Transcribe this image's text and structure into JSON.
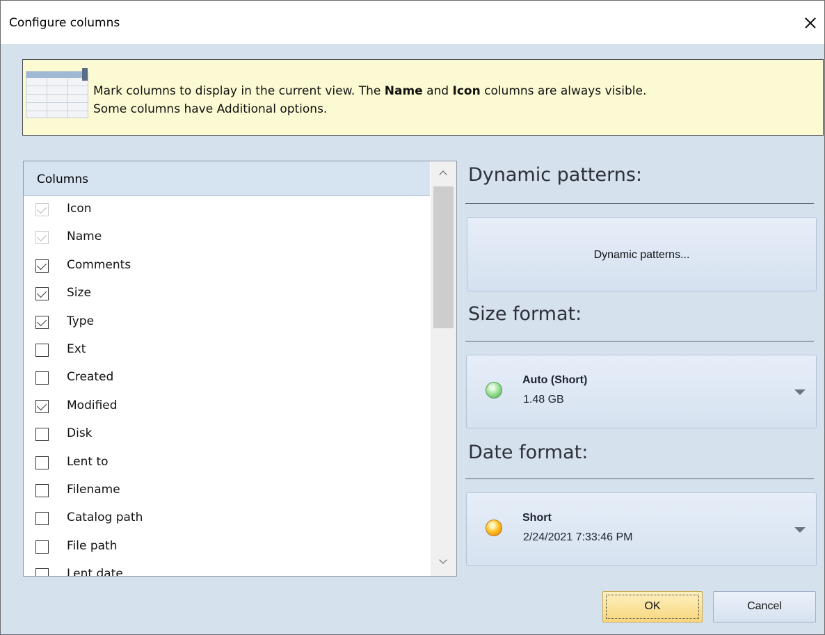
{
  "window": {
    "title": "Configure columns",
    "close_icon": "close-icon"
  },
  "info": {
    "icon": "table-columns-icon",
    "text_before": "Mark columns to display in the current view. The ",
    "bold1": "Name",
    "text_mid": " and ",
    "bold2": "Icon",
    "text_after": " columns are always visible.",
    "line2": "Some columns have Additional options."
  },
  "columns": {
    "header": "Columns",
    "items": [
      {
        "label": "Icon",
        "checked": true,
        "disabled": true
      },
      {
        "label": "Name",
        "checked": true,
        "disabled": true
      },
      {
        "label": "Comments",
        "checked": true,
        "disabled": false
      },
      {
        "label": "Size",
        "checked": true,
        "disabled": false
      },
      {
        "label": "Type",
        "checked": true,
        "disabled": false
      },
      {
        "label": "Ext",
        "checked": false,
        "disabled": false
      },
      {
        "label": "Created",
        "checked": false,
        "disabled": false
      },
      {
        "label": "Modified",
        "checked": true,
        "disabled": false
      },
      {
        "label": "Disk",
        "checked": false,
        "disabled": false
      },
      {
        "label": "Lent to",
        "checked": false,
        "disabled": false
      },
      {
        "label": "Filename",
        "checked": false,
        "disabled": false
      },
      {
        "label": "Catalog path",
        "checked": false,
        "disabled": false
      },
      {
        "label": "File path",
        "checked": false,
        "disabled": false
      },
      {
        "label": "Lent date",
        "checked": false,
        "disabled": false
      }
    ]
  },
  "dynamic": {
    "title": "Dynamic patterns:",
    "button_label": "Dynamic patterns..."
  },
  "size_format": {
    "title": "Size format:",
    "value": "Auto (Short)",
    "sample": "1.48 GB",
    "orb_color": "#7ed07a"
  },
  "date_format": {
    "title": "Date format:",
    "value": "Short",
    "sample": "2/24/2021 7:33:46 PM",
    "orb_color": "#ffb010"
  },
  "buttons": {
    "ok": "OK",
    "cancel": "Cancel"
  }
}
